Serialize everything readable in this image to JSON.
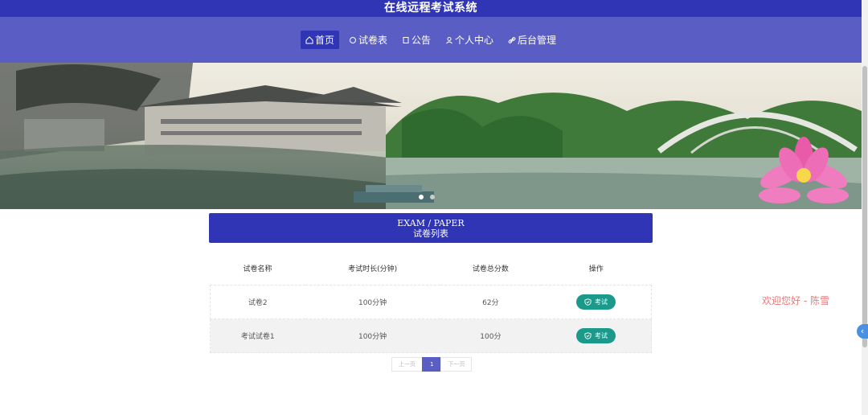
{
  "header": {
    "title": "在线远程考试系统"
  },
  "nav": [
    {
      "icon": "home-icon",
      "label": "首页",
      "active": true
    },
    {
      "icon": "circle-icon",
      "label": "试卷表",
      "active": false
    },
    {
      "icon": "note-icon",
      "label": "公告",
      "active": false
    },
    {
      "icon": "user-icon",
      "label": "个人中心",
      "active": false
    },
    {
      "icon": "link-icon",
      "label": "后台管理",
      "active": false
    }
  ],
  "section": {
    "en": "EXAM / PAPER",
    "cn": "试卷列表"
  },
  "table": {
    "headers": [
      "试卷名称",
      "考试时长(分钟)",
      "试卷总分数",
      "操作"
    ],
    "rows": [
      {
        "name": "试卷2",
        "duration": "100分钟",
        "score": "62分",
        "action": "考试"
      },
      {
        "name": "考试试卷1",
        "duration": "100分钟",
        "score": "100分",
        "action": "考试"
      }
    ]
  },
  "pager": {
    "prev": "上一页",
    "current": "1",
    "next": "下一页"
  },
  "welcome": "欢迎您好 - 陈雪",
  "colors": {
    "primary": "#2f35b4",
    "nav": "#5a5ec4",
    "button": "#1b998a"
  }
}
